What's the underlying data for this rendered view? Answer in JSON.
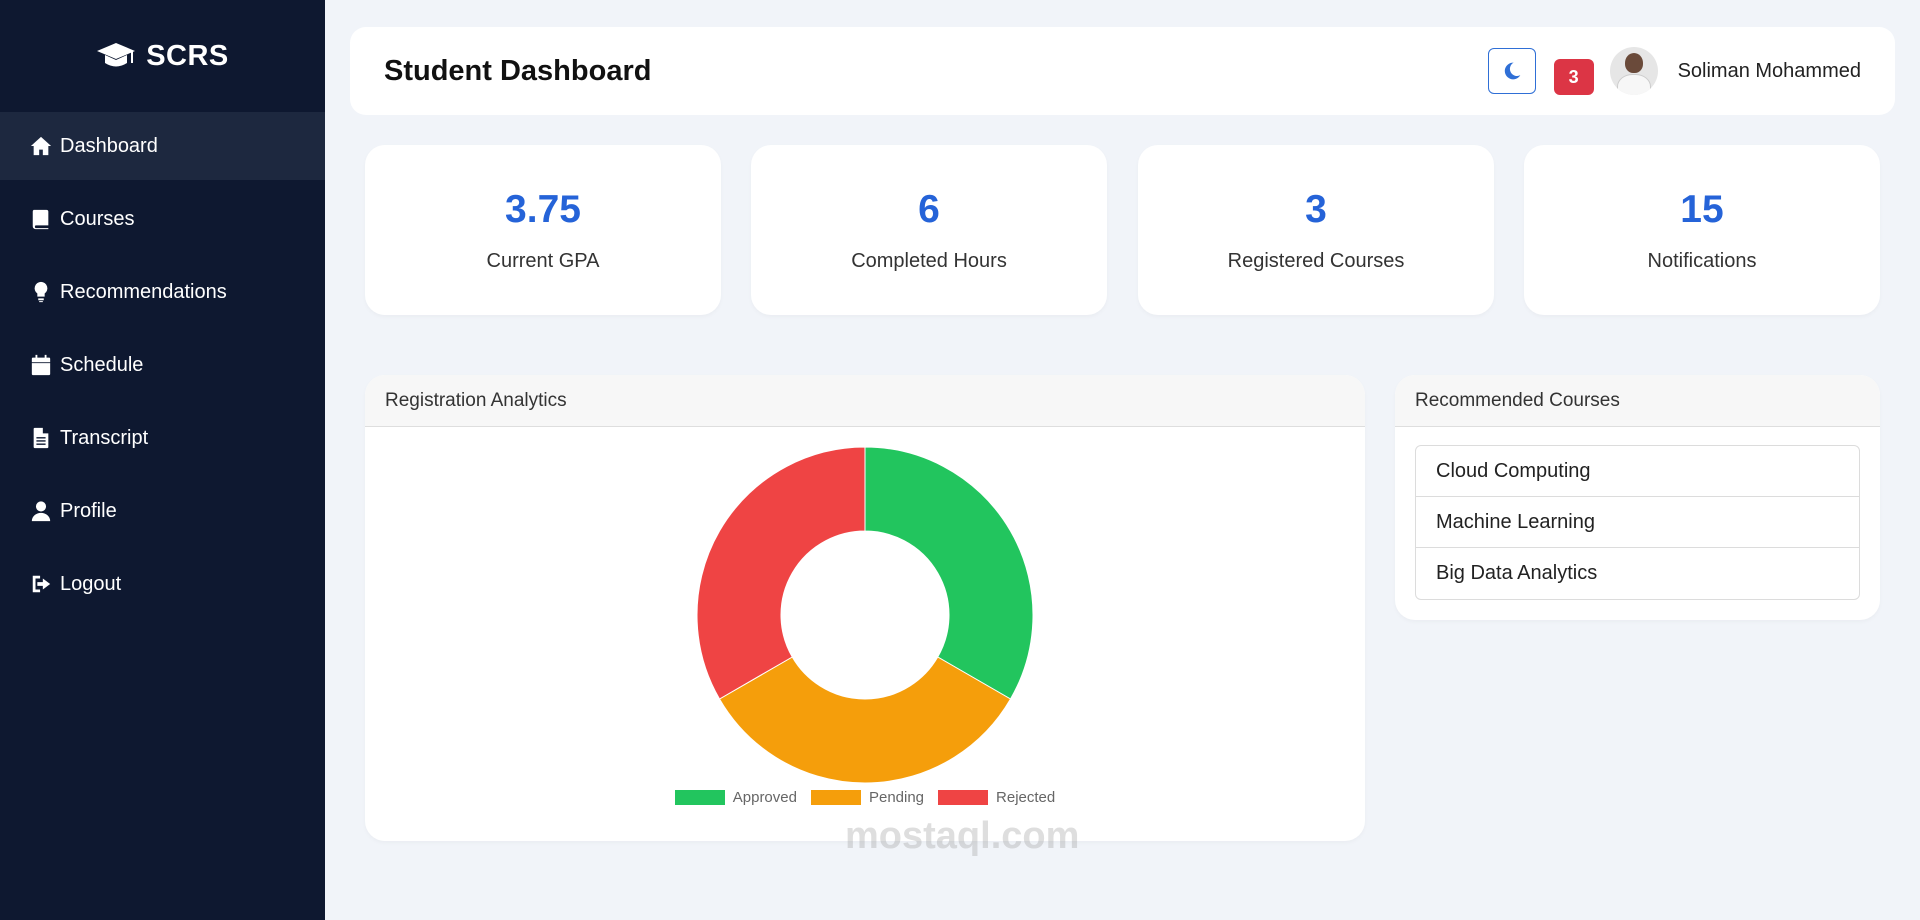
{
  "sidebar": {
    "brand": "SCRS",
    "items": [
      {
        "label": "Dashboard",
        "icon": "home-icon",
        "active": true
      },
      {
        "label": "Courses",
        "icon": "book-icon"
      },
      {
        "label": "Recommendations",
        "icon": "lightbulb-icon"
      },
      {
        "label": "Schedule",
        "icon": "calendar-icon"
      },
      {
        "label": "Transcript",
        "icon": "file-icon"
      },
      {
        "label": "Profile",
        "icon": "user-icon"
      },
      {
        "label": "Logout",
        "icon": "logout-icon"
      }
    ]
  },
  "header": {
    "title": "Student Dashboard",
    "notification_count": "3",
    "user_name": "Soliman Mohammed"
  },
  "stats": [
    {
      "value": "3.75",
      "label": "Current GPA"
    },
    {
      "value": "6",
      "label": "Completed Hours"
    },
    {
      "value": "3",
      "label": "Registered Courses"
    },
    {
      "value": "15",
      "label": "Notifications"
    }
  ],
  "analytics": {
    "title": "Registration Analytics"
  },
  "chart_data": {
    "type": "pie",
    "title": "",
    "categories": [
      "Approved",
      "Pending",
      "Rejected"
    ],
    "values": [
      1,
      1,
      1
    ],
    "colors": [
      "#22c55e",
      "#f59e0b",
      "#ef4444"
    ],
    "legend": "bottom",
    "donut": true
  },
  "recommended": {
    "title": "Recommended Courses",
    "items": [
      "Cloud Computing",
      "Machine Learning",
      "Big Data Analytics"
    ]
  },
  "watermark": "mostaql.com"
}
